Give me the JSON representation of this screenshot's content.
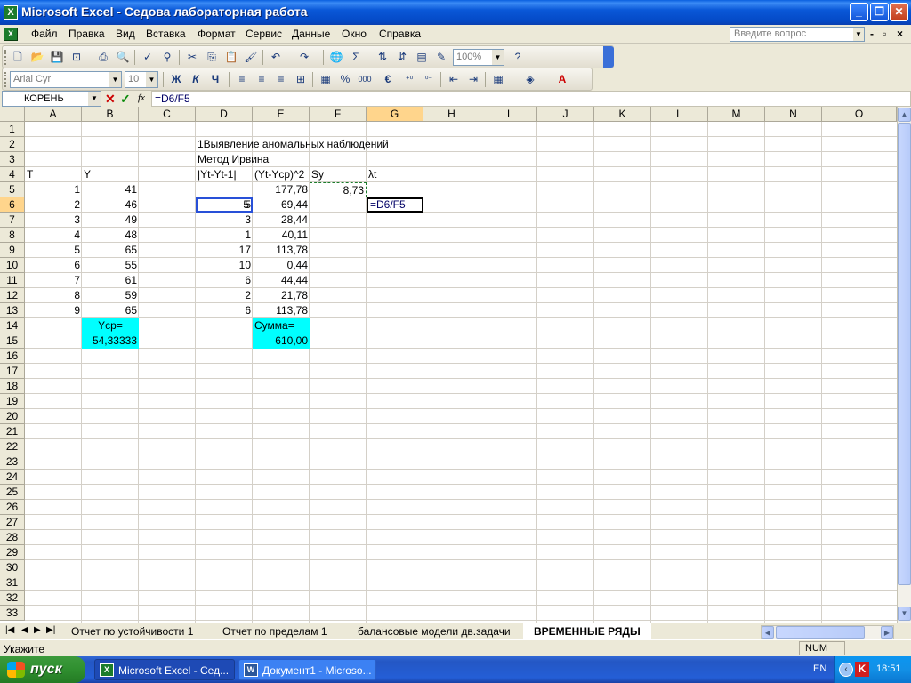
{
  "window": {
    "title": "Microsoft Excel - Седова лабораторная работа"
  },
  "menu": {
    "items": [
      "Файл",
      "Правка",
      "Вид",
      "Вставка",
      "Формат",
      "Сервис",
      "Данные",
      "Окно",
      "Справка"
    ],
    "help_placeholder": "Введите вопрос"
  },
  "toolbar": {
    "zoom": "100%",
    "font_name": "Arial Cyr",
    "font_size": "10",
    "bold": "Ж",
    "italic": "К",
    "underline": "Ч",
    "percent": "%",
    "thousands": "000",
    "euro": "€",
    "sum": "Σ"
  },
  "formula_bar": {
    "name_box": "КОРЕНЬ",
    "fx": "fx",
    "formula": "=D6/F5"
  },
  "grid": {
    "columns": [
      "A",
      "B",
      "C",
      "D",
      "E",
      "F",
      "G",
      "H",
      "I",
      "J",
      "K",
      "L",
      "M",
      "N",
      "O"
    ],
    "selected_column": "G",
    "selected_row": "6",
    "rows": [
      "1",
      "2",
      "3",
      "4",
      "5",
      "6",
      "7",
      "8",
      "9",
      "10",
      "11",
      "12",
      "13",
      "14",
      "15",
      "16",
      "17",
      "18",
      "19",
      "20",
      "21",
      "22",
      "23",
      "24",
      "25",
      "26",
      "27",
      "28",
      "29",
      "30",
      "31",
      "32",
      "33"
    ],
    "title1": "1Выявление аномальных наблюдений",
    "title2": "Метод Ирвина",
    "header_T": "T",
    "header_Y": "Y",
    "header_D": "|Yt-Yt-1|",
    "header_E": "(Yt-Yср)^2",
    "header_F": "Sy",
    "header_G": "λt",
    "col_A": [
      "1",
      "2",
      "3",
      "4",
      "5",
      "6",
      "7",
      "8",
      "9"
    ],
    "col_B": [
      "41",
      "46",
      "49",
      "48",
      "65",
      "55",
      "61",
      "59",
      "65"
    ],
    "col_D": [
      "5",
      "3",
      "1",
      "17",
      "10",
      "6",
      "2",
      "6"
    ],
    "col_E": [
      "177,78",
      "69,44",
      "28,44",
      "40,11",
      "113,78",
      "0,44",
      "44,44",
      "21,78",
      "113,78"
    ],
    "F5": "8,73",
    "G6": "=D6/F5",
    "ycp_label": "Yср=",
    "ycp_value": "54,33333",
    "sum_label": "Сумма=",
    "sum_value": "610,00",
    "highlight_color": "#00ffff"
  },
  "sheets": [
    {
      "name": "Отчет по устойчивости 1",
      "active": false
    },
    {
      "name": "Отчет по пределам 1",
      "active": false
    },
    {
      "name": "балансовые модели дв.задачи",
      "active": false
    },
    {
      "name": "ВРЕМЕННЫЕ РЯДЫ",
      "active": true
    }
  ],
  "status": {
    "text": "Укажите",
    "num": "NUM"
  },
  "taskbar": {
    "start": "пуск",
    "tasks": [
      "Microsoft Excel - Сед...",
      "Документ1 - Microso..."
    ],
    "lang": "EN",
    "clock": "18:51"
  }
}
